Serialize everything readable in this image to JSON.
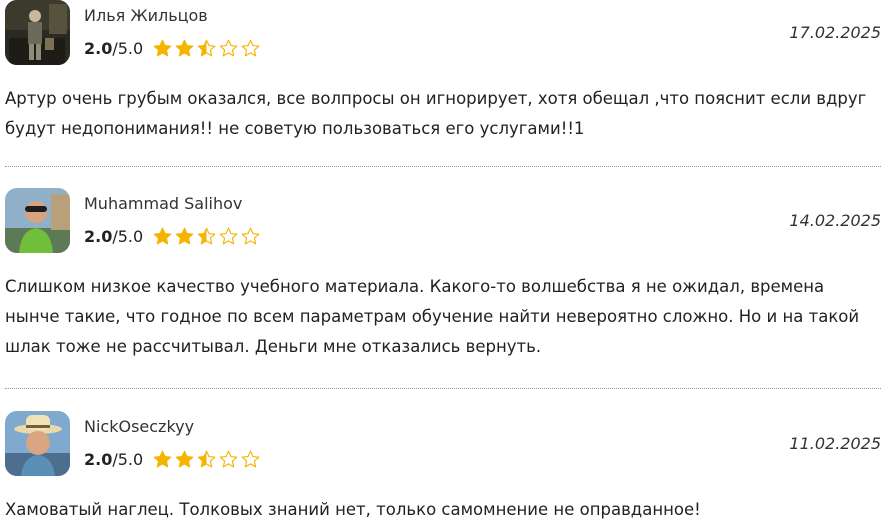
{
  "reviews": [
    {
      "author": "Илья Жильцов",
      "avatar": "user-photo-1",
      "rating_value": "2.0",
      "rating_max": "/5.0",
      "stars": 2.5,
      "date": "17.02.2025",
      "text": "Артур очень грубым оказался, все волпросы он игнорирует, хотя обещал ,что пояснит если вдруг будут недопонимания!! не советую пользоваться его услугами!!1"
    },
    {
      "author": "Muhammad Salihov",
      "avatar": "user-photo-2",
      "rating_value": "2.0",
      "rating_max": "/5.0",
      "stars": 2.5,
      "date": "14.02.2025",
      "text": "Слишком низкое качество учебного материала. Какого-то волшебства я не ожидал, времена нынче такие, что годное по всем параметрам обучение найти невероятно сложно. Но и на такой шлак тоже не рассчитывал. Деньги мне отказались вернуть."
    },
    {
      "author": "NickOseczkyy",
      "avatar": "user-photo-3",
      "rating_value": "2.0",
      "rating_max": "/5.0",
      "stars": 2.5,
      "date": "11.02.2025",
      "text": "Хамоватый наглец. Толковых знаний нет, только самомнение не оправданное!"
    }
  ],
  "colors": {
    "star": "#f5b400",
    "divider": "#9a9a9a"
  }
}
